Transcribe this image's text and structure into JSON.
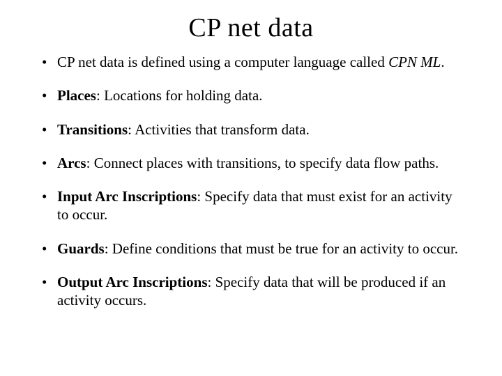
{
  "title": "CP net data",
  "bullets": [
    {
      "prefix": "CP net data is defined using a computer language called ",
      "term": "",
      "rest": "",
      "emph": "CPN ML",
      "tail": "."
    },
    {
      "term": "Places",
      "rest": ": Locations for holding data."
    },
    {
      "term": "Transitions",
      "rest": ": Activities that transform data."
    },
    {
      "term": "Arcs",
      "rest": ": Connect places with transitions, to specify data flow paths."
    },
    {
      "term": "Input Arc Inscriptions",
      "rest": ": Specify data that must exist for an activity to occur."
    },
    {
      "term": "Guards",
      "rest": ": Define conditions that must be true for an activity to occur."
    },
    {
      "term": "Output Arc Inscriptions",
      "rest": ": Specify data that will be produced if an activity occurs."
    }
  ]
}
